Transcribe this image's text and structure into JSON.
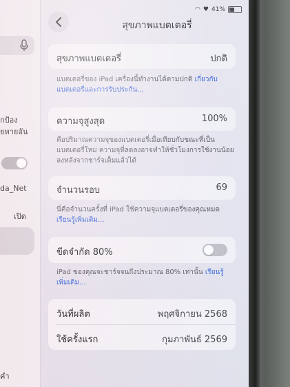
{
  "status_bar": {
    "battery": "41%"
  },
  "nav": {
    "title": "สุขภาพแบตเตอรี่",
    "back_label": "‹"
  },
  "sidebar": {
    "fragments": [
      "กป้อง",
      "ยหายอัน",
      "da_Net",
      "เปิด",
      "คำ"
    ],
    "toggle_on": false
  },
  "battery_health": {
    "label": "สุขภาพแบตเตอรี่",
    "value": "ปกติ",
    "note": "แบตเตอรี่ของ iPad เครื่องนี้ทำงานได้ตามปกติ",
    "note_link": "เกี่ยวกับแบตเตอรี่และการรับประกัน..."
  },
  "max_capacity": {
    "label": "ความจุสูงสุด",
    "value": "100%",
    "note": "คือปริมาณความจุของแบตเตอรี่เมื่อเทียบกับขณะที่เป็นแบตเตอรี่ใหม่ ความจุที่ลดลงอาจทำให้ชั่วโมงการใช้งานน้อยลงหลังจากชาร์จเต็มแล้วได้"
  },
  "cycle_count": {
    "label": "จำนวนรอบ",
    "value": "69",
    "note": "นี่คือจำนวนครั้งที่ iPad ใช้ความจุแบตเตอรี่ของคุณหมด",
    "note_link": "เรียนรู้เพิ่มเติม..."
  },
  "limit_80": {
    "label": "ขีดจำกัด 80%",
    "enabled": false,
    "note": "iPad ของคุณจะชาร์จจนถึงประมาณ 80% เท่านั้น",
    "note_link": "เรียนรู้เพิ่มเติม..."
  },
  "dates": {
    "manufacture_label": "วันที่ผลิต",
    "manufacture_value": "พฤศจิกายน 2568",
    "first_use_label": "ใช้ครั้งแรก",
    "first_use_value": "กุมภาพันธ์ 2569"
  },
  "colors": {
    "accent": "#2a5bd7",
    "background": "#ece8ee",
    "card": "#f6f4f6"
  }
}
